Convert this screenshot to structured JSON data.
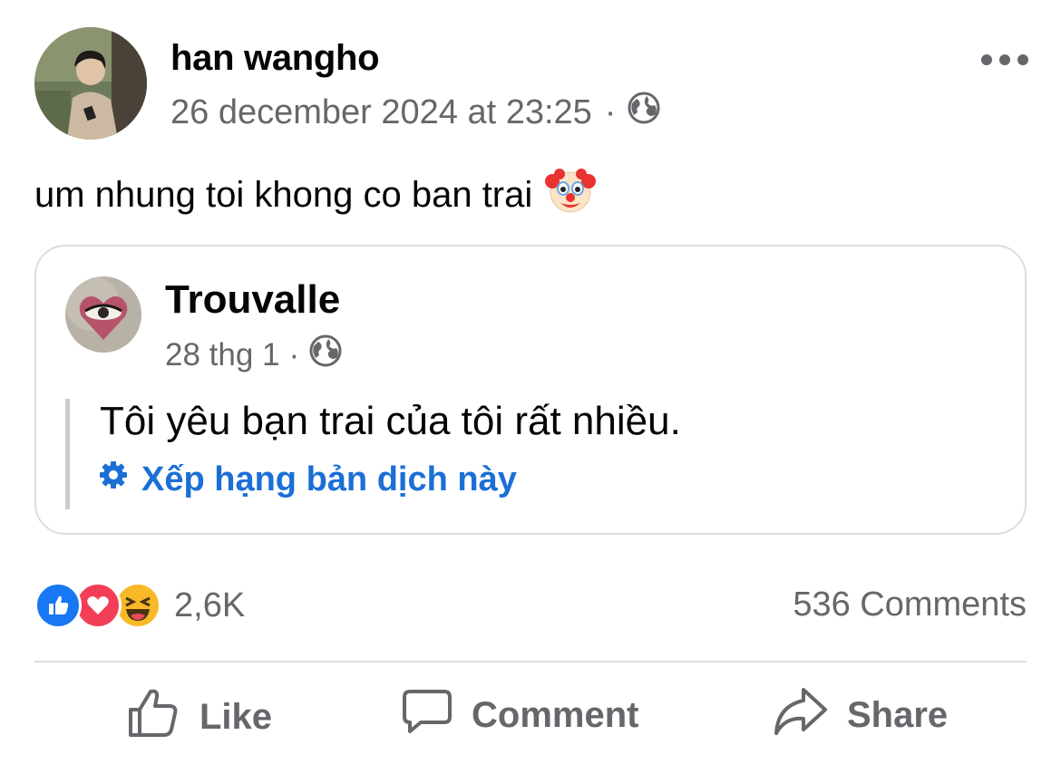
{
  "post": {
    "author": "han wangho",
    "timestamp": "26 december 2024 at 23:25",
    "separator": "·",
    "privacy_icon": "globe-icon",
    "more_icon": "more-dots-icon",
    "text": "um nhung toi khong co ban trai",
    "emoji": "🤡"
  },
  "shared_post": {
    "author": "Trouvalle",
    "timestamp": "28 thg 1",
    "separator": "·",
    "privacy_icon": "globe-icon",
    "text": "Tôi yêu bạn trai của tôi rất nhiều.",
    "translate_link": "Xếp hạng bản dịch này",
    "translate_icon": "gear-icon"
  },
  "stats": {
    "reactions": [
      "like",
      "love",
      "haha"
    ],
    "reaction_count": "2,6K",
    "comments": "536 Comments"
  },
  "actions": {
    "like": "Like",
    "comment": "Comment",
    "share": "Share"
  },
  "colors": {
    "link_blue": "#1b6fd6",
    "secondary_text": "#65676b",
    "like_blue": "#1877f2",
    "love_red": "#f33e58",
    "haha_yellow": "#f7b928"
  }
}
